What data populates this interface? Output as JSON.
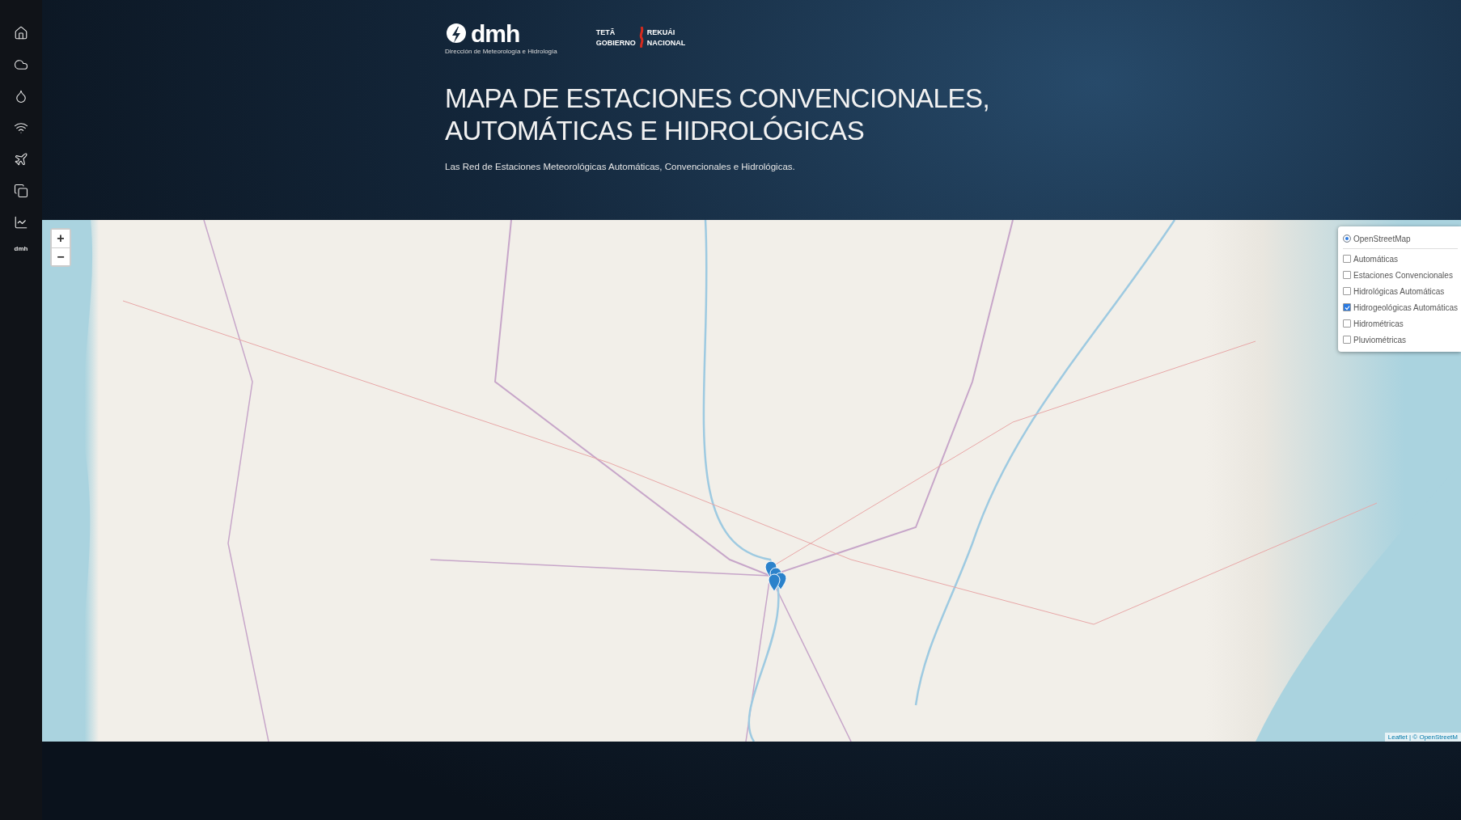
{
  "sidebar": {
    "items": [
      {
        "kind": "home"
      },
      {
        "kind": "cloud"
      },
      {
        "kind": "drop"
      },
      {
        "kind": "wifi"
      },
      {
        "kind": "plane"
      },
      {
        "kind": "panels"
      },
      {
        "kind": "chart"
      },
      {
        "kind": "text",
        "label": "dmh"
      }
    ]
  },
  "header": {
    "logo": {
      "name": "dmh",
      "subtitle": "Dirección de Meteorología e Hidrología"
    },
    "partner_logo": {
      "line_1_left": "TETÃ",
      "line_1_right": "REKUÁI",
      "line_2_left": "GOBIERNO",
      "line_2_right": "NACIONAL"
    },
    "title_lines": [
      "MAPA DE ESTACIONES CONVENCIONALES,",
      "AUTOMÁTICAS E HIDROLÓGICAS"
    ],
    "subtitle": "Las Red de Estaciones Meteorológicas Automáticas, Convencionales e Hidrológicas."
  },
  "map": {
    "zoom_in": "+",
    "zoom_out": "−",
    "base_layers": [
      {
        "label": "OpenStreetMap",
        "selected": true
      }
    ],
    "overlays": [
      {
        "label": "Automáticas",
        "checked": false
      },
      {
        "label": "Estaciones Convencionales",
        "checked": false
      },
      {
        "label": "Hidrológicas Automáticas",
        "checked": false
      },
      {
        "label": "Hidrogeológicas Automáticas",
        "checked": true
      },
      {
        "label": "Hidrométricas",
        "checked": false
      },
      {
        "label": "Pluviométricas",
        "checked": false
      }
    ],
    "attribution": "Leaflet | © OpenStreetM"
  }
}
